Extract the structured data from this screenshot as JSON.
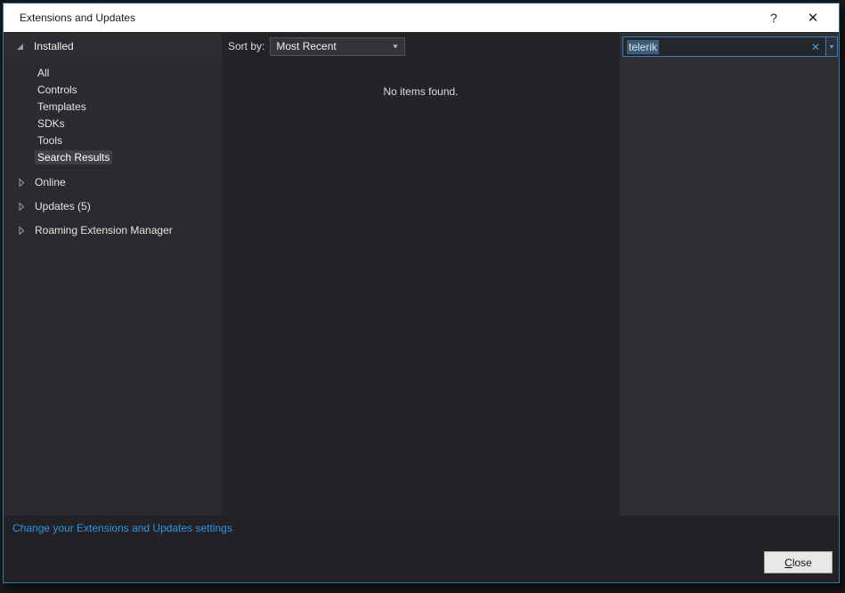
{
  "window": {
    "title": "Extensions and Updates",
    "help_icon": "?",
    "close_icon": "✕"
  },
  "sidebar": {
    "installed": {
      "label": "Installed",
      "expanded": true,
      "children": [
        "All",
        "Controls",
        "Templates",
        "SDKs",
        "Tools",
        "Search Results"
      ],
      "selected": "Search Results"
    },
    "groups": [
      {
        "label": "Online"
      },
      {
        "label": "Updates (5)"
      },
      {
        "label": "Roaming Extension Manager"
      }
    ]
  },
  "main": {
    "sort_label": "Sort by:",
    "sort_value": "Most Recent",
    "dropdown_arrow": "▼",
    "empty_message": "No items found."
  },
  "search": {
    "value": "telerik",
    "selected": true,
    "clear_icon": "✕",
    "dropdown_arrow": "▼"
  },
  "footer": {
    "settings_link": "Change your Extensions and Updates settings",
    "close_button_accesskey": "C",
    "close_button_rest": "lose"
  },
  "colors": {
    "window_border": "#2e76ad",
    "titlebar_bg": "#ffffff",
    "sidebar_bg": "#2b2b2f",
    "middle_bg": "#242428",
    "right_bg": "#2e2e33",
    "selection_bg": "#3f5c78",
    "selected_item_bg": "#3f3f46",
    "link_color": "#3193e3",
    "search_border": "#3a7cb8",
    "close_button_bg": "#e8e8e8"
  }
}
